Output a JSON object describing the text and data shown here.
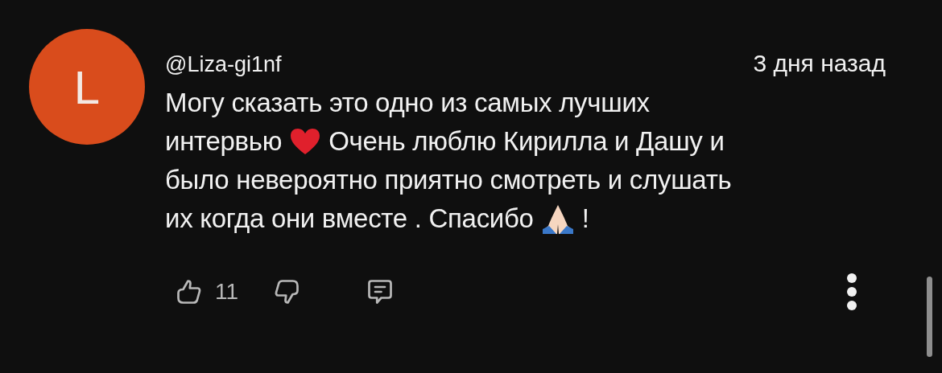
{
  "comment": {
    "avatar_letter": "L",
    "author": "@Liza-gi1nf",
    "time": "3 дня назад",
    "lines": [
      [
        {
          "kind": "text",
          "text": "Могу сказать это одно из самых лучших"
        }
      ],
      [
        {
          "kind": "text",
          "text": "интервью"
        },
        {
          "kind": "heart"
        },
        {
          "kind": "text",
          "text": "Очень люблю Кирилла и Дашу и"
        }
      ],
      [
        {
          "kind": "text",
          "text": "было невероятно приятно смотреть и слушать"
        }
      ],
      [
        {
          "kind": "text",
          "text": "их когда они вместе . Спасибо"
        },
        {
          "kind": "hands"
        },
        {
          "kind": "text",
          "text": "!"
        }
      ]
    ],
    "likes": "11"
  }
}
